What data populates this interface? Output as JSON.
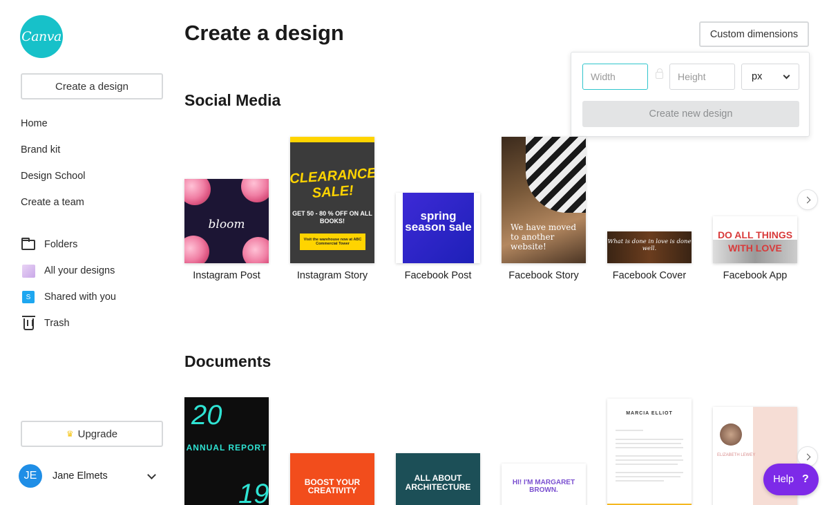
{
  "brand": {
    "logo_text": "Canva",
    "accent": "#17c1c9"
  },
  "sidebar": {
    "create_label": "Create a design",
    "nav": [
      {
        "label": "Home"
      },
      {
        "label": "Brand kit"
      },
      {
        "label": "Design School"
      },
      {
        "label": "Create a team"
      }
    ],
    "nav2": [
      {
        "label": "Folders",
        "icon": "folder-icon"
      },
      {
        "label": "All your designs",
        "icon": "designs-thumb-icon"
      },
      {
        "label": "Shared with you",
        "icon": "shared-icon",
        "icon_text": "S"
      },
      {
        "label": "Trash",
        "icon": "trash-icon"
      }
    ],
    "upgrade_label": "Upgrade",
    "user": {
      "initials": "JE",
      "name": "Jane Elmets"
    }
  },
  "main": {
    "title": "Create a design",
    "custom_dimensions_label": "Custom dimensions",
    "popover": {
      "width_placeholder": "Width",
      "height_placeholder": "Height",
      "unit": "px",
      "create_label": "Create new design"
    },
    "sections": [
      {
        "title": "Social Media",
        "items": [
          {
            "label": "Instagram Post",
            "art": "bloom"
          },
          {
            "label": "Instagram Story",
            "art": "CLEARANCE SALE!",
            "art2": "GET 50 - 80 % OFF ON ALL BOOKS!",
            "art3": "Visit the warehouse now at ABC Commercial Tower"
          },
          {
            "label": "Facebook Post",
            "art": "spring season sale"
          },
          {
            "label": "Facebook Story",
            "art": "We have moved to another website!"
          },
          {
            "label": "Facebook Cover",
            "art": "What is done in love is done well."
          },
          {
            "label": "Facebook App",
            "art": "DO ALL THINGS WITH LOVE"
          }
        ]
      },
      {
        "title": "Documents",
        "items": [
          {
            "art": "20",
            "art2": "ANNUAL REPORT",
            "art3": "19"
          },
          {
            "art": "BOOST YOUR CREATIVITY"
          },
          {
            "art": "ALL ABOUT ARCHITECTURE"
          },
          {
            "art": "HI! I'M MARGARET BROWN."
          },
          {
            "art": "MARCIA ELLIOT"
          },
          {
            "art": "ELIZABETH LEWEY"
          }
        ]
      }
    ]
  },
  "help": {
    "label": "Help",
    "icon": "?"
  }
}
